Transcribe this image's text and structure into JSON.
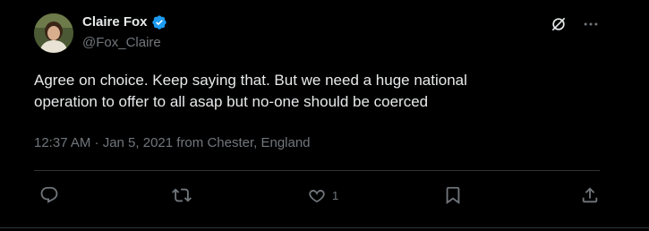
{
  "user": {
    "display_name": "Claire Fox",
    "handle": "@Fox_Claire",
    "verified": true
  },
  "tweet": {
    "text_line1": "Agree on choice. Keep saying that. But we need a huge national",
    "text_line2": "operation to offer to all asap but no-one should be coerced",
    "meta": "12:37 AM · Jan 5, 2021 from Chester, England"
  },
  "actions": {
    "reply_icon": "reply-icon",
    "retweet_icon": "retweet-icon",
    "like_icon": "heart-icon",
    "like_count": "1",
    "bookmark_icon": "bookmark-icon",
    "share_icon": "share-icon"
  },
  "colors": {
    "background": "#000000",
    "text": "#e7e9ea",
    "secondary": "#71767b",
    "verified": "#1d9bf0"
  }
}
